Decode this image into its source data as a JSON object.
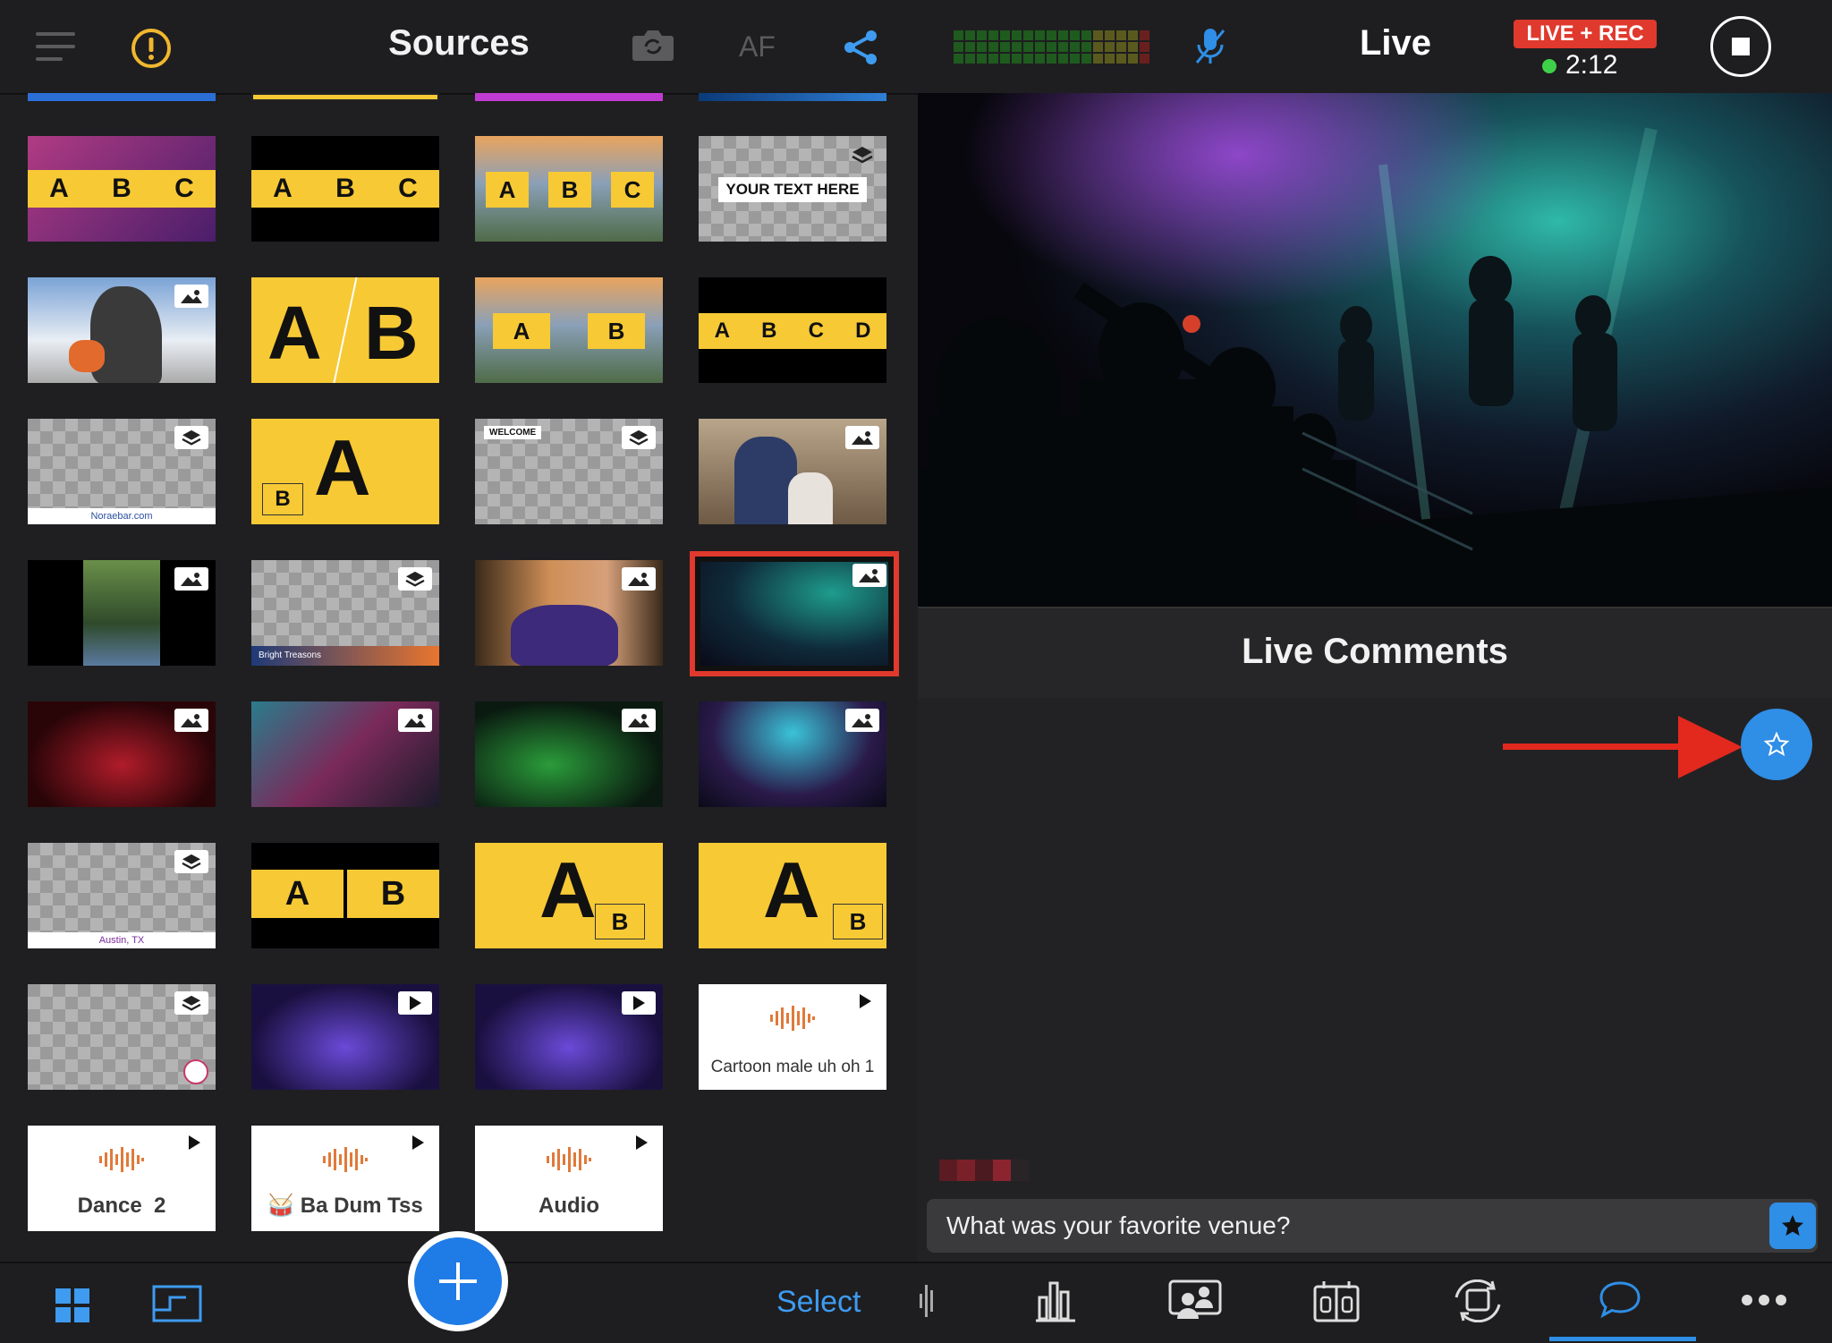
{
  "left_panel": {
    "title": "Sources",
    "af_label": "AF",
    "select_label": "Select"
  },
  "tiles": {
    "abc_label_a": "A",
    "abc_label_b": "B",
    "abc_label_c": "C",
    "abc_label_d": "D",
    "your_text_here": "YOUR TEXT HERE",
    "noraebar": "Noraebar.com",
    "welcome": "WELCOME",
    "bright_treasons": "Bright Treasons",
    "austin_tx": "Austin, TX",
    "audio_1": "Cartoon male uh oh 1",
    "audio_2": "Dance  2",
    "audio_3": "🥁 Ba Dum Tss",
    "audio_4": "Audio"
  },
  "right_panel": {
    "title": "Live",
    "status_badge": "LIVE + REC",
    "timer": "2:12",
    "comments_title": "Live Comments",
    "comment_text": "What was your favorite venue?"
  },
  "colors": {
    "accent": "#2f8ee6",
    "tile_yellow": "#f7c935",
    "live_red": "#e0392d",
    "rec_green": "#3fd04a",
    "selection_red": "#e0392d"
  }
}
